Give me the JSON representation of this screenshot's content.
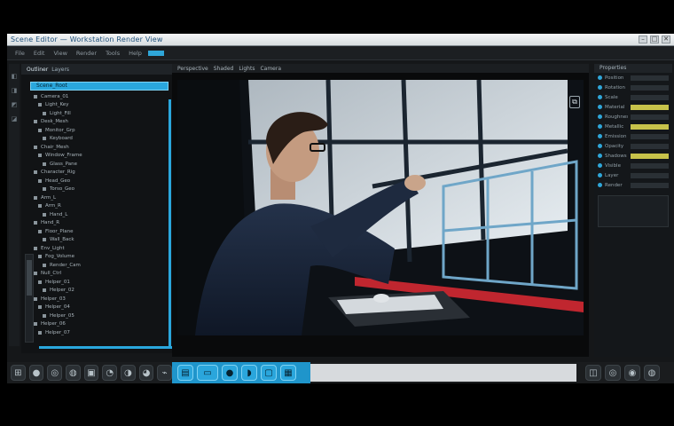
{
  "window": {
    "title": "Scene Editor — Workstation Render View",
    "controls": [
      "–",
      "□",
      "✕"
    ]
  },
  "menubar": {
    "items": [
      "File",
      "Edit",
      "View",
      "Render",
      "Tools",
      "Help"
    ]
  },
  "left_panel": {
    "tabs": [
      "Outliner",
      "Layers"
    ],
    "selected_item": "Scene_Root",
    "tree": [
      "Camera_01",
      "Light_Key",
      "Light_Fill",
      "Desk_Mesh",
      "Monitor_Grp",
      "Keyboard",
      "Chair_Mesh",
      "Window_Frame",
      "Glass_Pane",
      "Character_Rig",
      "Head_Geo",
      "Torso_Geo",
      "Arm_L",
      "Arm_R",
      "Hand_L",
      "Hand_R",
      "Floor_Plane",
      "Wall_Back",
      "Env_Light",
      "Fog_Volume",
      "Render_Cam",
      "Null_Ctrl",
      "Helper_01",
      "Helper_02",
      "Helper_03",
      "Helper_04",
      "Helper_05",
      "Helper_06",
      "Helper_07"
    ],
    "rail_icons": [
      "◧",
      "◨",
      "◩",
      "◪"
    ]
  },
  "viewport": {
    "header": [
      "Perspective",
      "Shaded",
      "Lights",
      "Camera"
    ],
    "corner_icon": "expand-icon"
  },
  "right_panel": {
    "header": "Properties",
    "props": [
      {
        "label": "Position",
        "highlight": false
      },
      {
        "label": "Rotation",
        "highlight": false
      },
      {
        "label": "Scale",
        "highlight": false
      },
      {
        "label": "Material",
        "highlight": true
      },
      {
        "label": "Roughness",
        "highlight": false
      },
      {
        "label": "Metallic",
        "highlight": true
      },
      {
        "label": "Emission",
        "highlight": false
      },
      {
        "label": "Opacity",
        "highlight": false
      },
      {
        "label": "Shadows",
        "highlight": true
      },
      {
        "label": "Visible",
        "highlight": false
      },
      {
        "label": "Layer",
        "highlight": false
      },
      {
        "label": "Render",
        "highlight": false
      }
    ]
  },
  "bottombar": {
    "left_buttons": [
      "⊞",
      "●",
      "◎",
      "◍",
      "▣",
      "◔",
      "◑",
      "◕",
      "⌁"
    ],
    "mid_buttons": [
      "▤",
      "▭",
      "●",
      "◗",
      "▢",
      "▦"
    ],
    "right_buttons": [
      "◫",
      "◎",
      "◉",
      "◍"
    ]
  }
}
